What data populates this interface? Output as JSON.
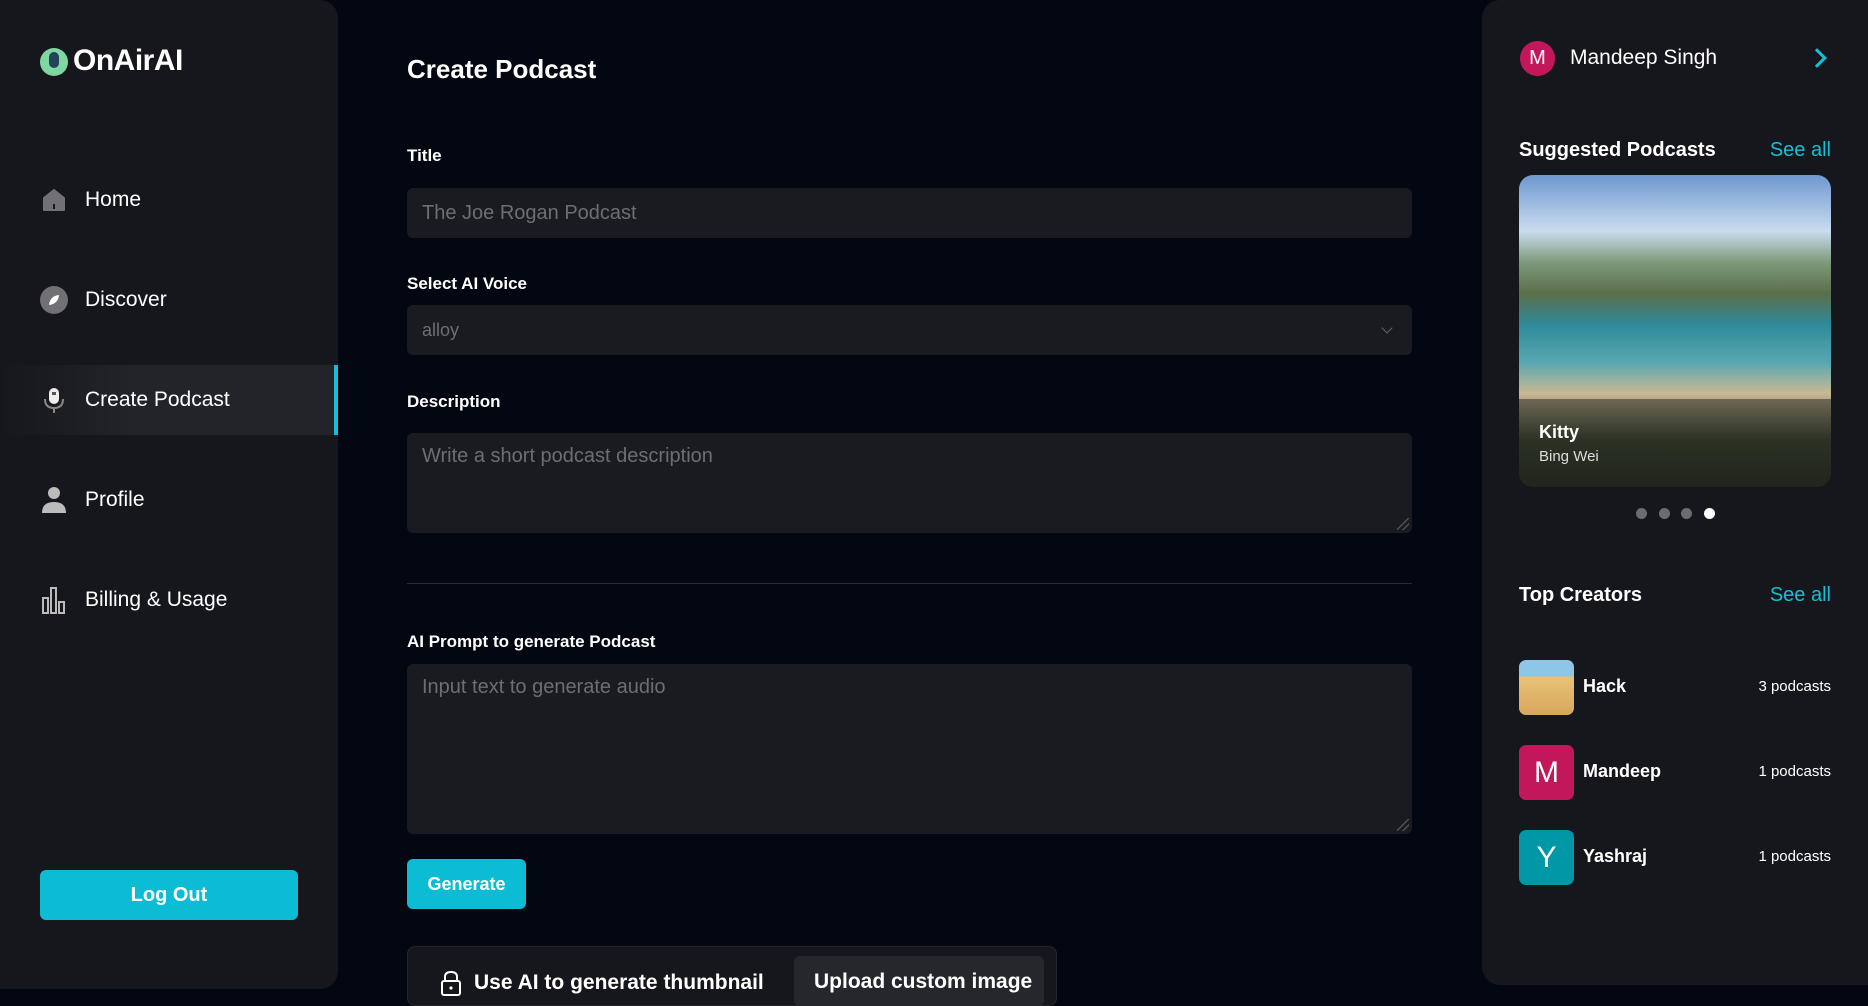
{
  "app": {
    "name": "OnAirAI"
  },
  "sidebar": {
    "items": [
      {
        "label": "Home",
        "icon": "home-icon"
      },
      {
        "label": "Discover",
        "icon": "compass-icon"
      },
      {
        "label": "Create Podcast",
        "icon": "microphone-icon",
        "active": true
      },
      {
        "label": "Profile",
        "icon": "user-icon"
      },
      {
        "label": "Billing & Usage",
        "icon": "bar-chart-icon"
      }
    ],
    "logout": "Log Out"
  },
  "main": {
    "title": "Create Podcast",
    "title_label": "Title",
    "title_placeholder": "The Joe Rogan Podcast",
    "voice_label": "Select AI Voice",
    "voice_value": "alloy",
    "desc_label": "Description",
    "desc_placeholder": "Write a short podcast description",
    "prompt_label": "AI Prompt to generate Podcast",
    "prompt_placeholder": "Input text to generate audio",
    "generate": "Generate",
    "thumb_ai": "Use AI to generate thumbnail",
    "thumb_upload": "Upload custom image"
  },
  "right": {
    "user": {
      "initial": "M",
      "name": "Mandeep Singh"
    },
    "suggested": {
      "title": "Suggested Podcasts",
      "see_all": "See all",
      "card": {
        "title": "Kitty",
        "author": "Bing Wei"
      },
      "active_slide": 4,
      "slides": 4
    },
    "creators": {
      "title": "Top Creators",
      "see_all": "See all",
      "items": [
        {
          "name": "Hack",
          "count": "3 podcasts",
          "initial": ""
        },
        {
          "name": "Mandeep",
          "count": "1 podcasts",
          "initial": "M",
          "color": "#c2185b"
        },
        {
          "name": "Yashraj",
          "count": "1 podcasts",
          "initial": "Y",
          "color": "#0097a7"
        }
      ]
    }
  },
  "colors": {
    "accent": "#0bbcd4",
    "bg": "#030711",
    "panel": "#16171c"
  }
}
